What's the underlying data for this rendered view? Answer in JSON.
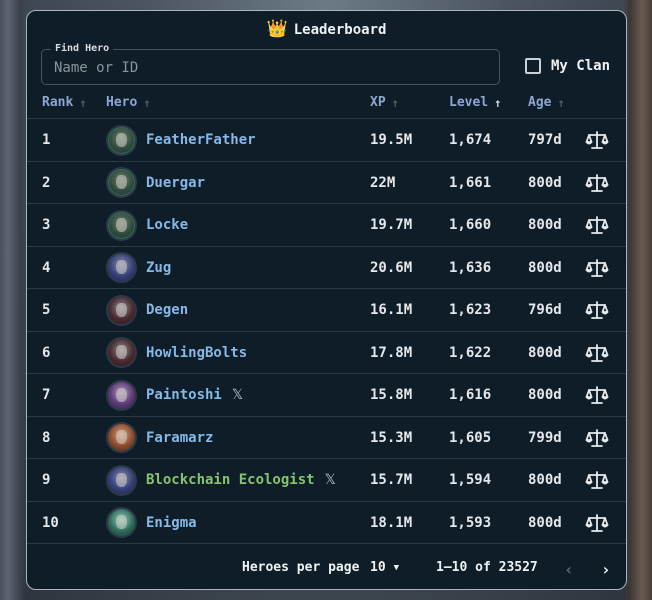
{
  "title": "Leaderboard",
  "search": {
    "legend": "Find Hero",
    "placeholder": "Name or ID",
    "value": ""
  },
  "clan_filter": {
    "label": "My Clan",
    "checked": false
  },
  "columns": {
    "rank": "Rank",
    "hero": "Hero",
    "xp": "XP",
    "level": "Level",
    "age": "Age",
    "sorted_by": "Level"
  },
  "rows": [
    {
      "rank": "1",
      "name": "FeatherFather",
      "xp": "19.5M",
      "level": "1,674",
      "age": "797d",
      "avatar": "green",
      "x_link": false,
      "name_color": "blue"
    },
    {
      "rank": "2",
      "name": "Duergar",
      "xp": "22M",
      "level": "1,661",
      "age": "800d",
      "avatar": "green",
      "x_link": false,
      "name_color": "blue"
    },
    {
      "rank": "3",
      "name": "Locke",
      "xp": "19.7M",
      "level": "1,660",
      "age": "800d",
      "avatar": "green",
      "x_link": false,
      "name_color": "blue"
    },
    {
      "rank": "4",
      "name": "Zug",
      "xp": "20.6M",
      "level": "1,636",
      "age": "800d",
      "avatar": "blue",
      "x_link": false,
      "name_color": "blue"
    },
    {
      "rank": "5",
      "name": "Degen",
      "xp": "16.1M",
      "level": "1,623",
      "age": "796d",
      "avatar": "red",
      "x_link": false,
      "name_color": "blue"
    },
    {
      "rank": "6",
      "name": "HowlingBolts",
      "xp": "17.8M",
      "level": "1,622",
      "age": "800d",
      "avatar": "red",
      "x_link": false,
      "name_color": "blue"
    },
    {
      "rank": "7",
      "name": "Paintoshi",
      "xp": "15.8M",
      "level": "1,616",
      "age": "800d",
      "avatar": "purple",
      "x_link": true,
      "name_color": "blue"
    },
    {
      "rank": "8",
      "name": "Faramarz",
      "xp": "15.3M",
      "level": "1,605",
      "age": "799d",
      "avatar": "orange",
      "x_link": false,
      "name_color": "blue"
    },
    {
      "rank": "9",
      "name": "Blockchain Ecologist",
      "xp": "15.7M",
      "level": "1,594",
      "age": "800d",
      "avatar": "blue",
      "x_link": true,
      "name_color": "green"
    },
    {
      "rank": "10",
      "name": "Enigma",
      "xp": "18.1M",
      "level": "1,593",
      "age": "800d",
      "avatar": "teal",
      "x_link": false,
      "name_color": "blue"
    }
  ],
  "pagination": {
    "per_page_label": "Heroes per page",
    "per_page_value": "10",
    "range": "1–10 of 23527"
  },
  "icons": {
    "title": "crown-icon",
    "action": "compare-scale-icon",
    "social": "x-icon"
  }
}
